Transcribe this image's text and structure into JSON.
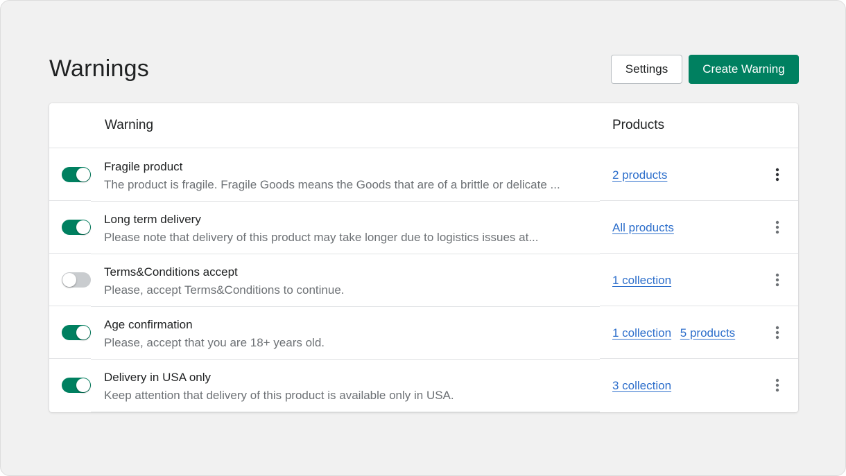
{
  "page": {
    "title": "Warnings"
  },
  "actions": {
    "settings_label": "Settings",
    "create_label": "Create Warning",
    "create_color": "#008060"
  },
  "table": {
    "headers": {
      "warning": "Warning",
      "products": "Products"
    },
    "rows": [
      {
        "enabled": true,
        "title": "Fragile product",
        "description": "The product is fragile. Fragile Goods means the Goods that are of a brittle or delicate ...",
        "links": [
          "2 products"
        ],
        "more_icon": "vertical-dots-icon"
      },
      {
        "enabled": true,
        "title": "Long term delivery",
        "description": "Please note that delivery of this product may take longer due to logistics issues at...",
        "links": [
          "All products"
        ],
        "more_icon": "vertical-dots-icon"
      },
      {
        "enabled": false,
        "title": "Terms&Conditions accept",
        "description": "Please, accept Terms&Conditions to continue.",
        "links": [
          "1 collection"
        ],
        "more_icon": "vertical-dots-icon"
      },
      {
        "enabled": true,
        "title": "Age confirmation",
        "description": "Please, accept that you are 18+ years old.",
        "links": [
          "1 collection",
          "5 products"
        ],
        "more_icon": "vertical-dots-icon"
      },
      {
        "enabled": true,
        "title": "Delivery in USA only",
        "description": "Keep attention that delivery of this product is available only in USA.",
        "links": [
          "3 collection"
        ],
        "more_icon": "vertical-dots-icon"
      }
    ]
  },
  "colors": {
    "toggle_on": "#008060",
    "toggle_off": "#c9cccf",
    "link": "#2c6ecb"
  }
}
